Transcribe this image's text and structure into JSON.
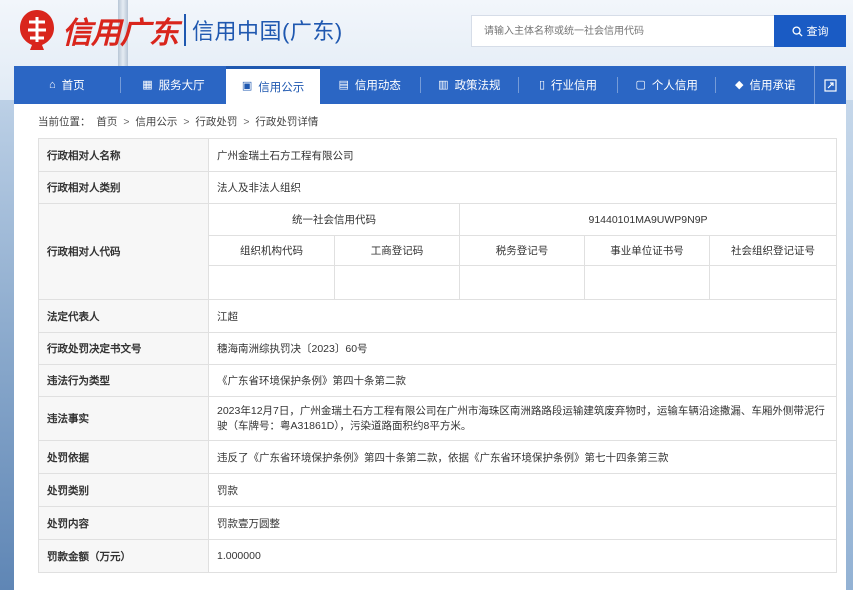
{
  "header": {
    "logo_script": "信用广东",
    "logo_text": "信用中国(广东)",
    "search_placeholder": "请输入主体名称或统一社会信用代码",
    "search_label": "查询"
  },
  "nav": {
    "items": [
      {
        "icon": "home-icon",
        "glyph": "⌂",
        "label": "首页"
      },
      {
        "icon": "grid-icon",
        "glyph": "▦",
        "label": "服务大厅"
      },
      {
        "icon": "announce-icon",
        "glyph": "▣",
        "label": "信用公示"
      },
      {
        "icon": "news-icon",
        "glyph": "▤",
        "label": "信用动态"
      },
      {
        "icon": "law-icon",
        "glyph": "▥",
        "label": "政策法规"
      },
      {
        "icon": "building-icon",
        "glyph": "▯",
        "label": "行业信用"
      },
      {
        "icon": "person-card-icon",
        "glyph": "▢",
        "label": "个人信用"
      },
      {
        "icon": "shield-icon",
        "glyph": "◆",
        "label": "信用承诺"
      }
    ],
    "active_index": 2
  },
  "breadcrumb": {
    "prefix": "当前位置：",
    "items": [
      "首页",
      "信用公示",
      "行政处罚",
      "行政处罚详情"
    ]
  },
  "detail": {
    "name_label": "行政相对人名称",
    "name_value": "广州金瑞土石方工程有限公司",
    "type_label": "行政相对人类别",
    "type_value": "法人及非法人组织",
    "code_label": "行政相对人代码",
    "uscc_label": "统一社会信用代码",
    "uscc_value": "91440101MA9UWP9N9P",
    "org_code_label": "组织机构代码",
    "biz_reg_label": "工商登记码",
    "tax_reg_label": "税务登记号",
    "inst_cert_label": "事业单位证书号",
    "social_org_label": "社会组织登记证号",
    "org_code_value": "",
    "biz_reg_value": "",
    "tax_reg_value": "",
    "inst_cert_value": "",
    "social_org_value": "",
    "legal_rep_label": "法定代表人",
    "legal_rep_value": "江超",
    "doc_no_label": "行政处罚决定书文号",
    "doc_no_value": "穗海南洲综执罚决〔2023〕60号",
    "violation_type_label": "违法行为类型",
    "violation_type_value": "《广东省环境保护条例》第四十条第二款",
    "facts_label": "违法事实",
    "facts_value": "2023年12月7日，广州金瑞土石方工程有限公司在广州市海珠区南洲路路段运输建筑废弃物时，运输车辆沿途撒漏、车厢外侧带泥行驶（车牌号：粤A31861D），污染道路面积约8平方米。",
    "basis_label": "处罚依据",
    "basis_value": "违反了《广东省环境保护条例》第四十条第二款，依据《广东省环境保护条例》第七十四条第三款",
    "category_label": "处罚类别",
    "category_value": "罚款",
    "content_label": "处罚内容",
    "content_value": "罚款壹万圆整",
    "amount_label": "罚款金额（万元）",
    "amount_value": "1.000000"
  },
  "colors": {
    "primary": "#2b66c4",
    "brand_red": "#d9251c",
    "label_bg": "#f7f7f7"
  }
}
